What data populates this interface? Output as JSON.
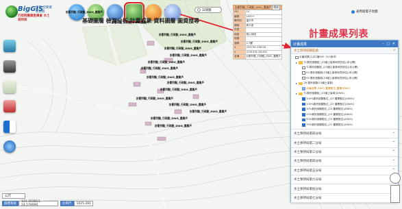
{
  "app": {
    "brand": "BigGIS",
    "brand_sub": "巨量 空間資訊系統",
    "unit": "行政院農業委員會 水土保持局"
  },
  "toolbar": {
    "caption": "基礎圖層 檢測分析 計畫成果 資料圖層 圖資搜尋"
  },
  "map_toggle": {
    "label": "日間圖"
  },
  "coord_select": {
    "label": "通用版電子地圖"
  },
  "callout": {
    "title": "計畫成果列表"
  },
  "attr_table": {
    "title": "計劃列點_行政點_DWG_農業戶",
    "close": "關閉",
    "rows": [
      {
        "k": "FID",
        "v": "10"
      },
      {
        "k": "編號",
        "v": "1000+"
      },
      {
        "k": "縣市別",
        "v": "臺中市"
      },
      {
        "k": "鄉鎮",
        "v": "和平區"
      },
      {
        "k": "村里",
        "v": ""
      },
      {
        "k": "地段",
        "v": "梨山地段"
      },
      {
        "k": "地號",
        "v": ""
      },
      {
        "k": "面積",
        "v": "2.7鍵"
      },
      {
        "k": "X",
        "v": "253790.376026"
      },
      {
        "k": "Y",
        "v": "2734378.330591"
      },
      {
        "k": "名稱",
        "v": "計劃列點_行政點_DWG_農業戶"
      }
    ]
  },
  "parcel_labels": [
    "計劃列點_行政點_DWG_農業戶",
    "計劃列點_行政點_DWG_農業戶",
    "計劃列點_行政點_DWG_農業戶",
    "計劃列點_行政點_DWG_農業戶",
    "計劃列點_行政點_DWG_農業戶",
    "計劃列點_行政點_DWG_農業戶",
    "計劃列點_行政點_DWG_農業戶",
    "計劃列點_行政點_DWG_農業戶",
    "計劃列點_行政點_DWG_農業戶",
    "計劃列點_行政點_DWG_農業戶",
    "計劃列點_行政點_DWG_農業戶",
    "計劃列點_行政點_DWG_農業戶",
    "計劃列點_行政點_DWG_農業戶",
    "計劃列點_行政點_DWG_農業戶",
    "計劃列點_行政點_DWG_農業戶",
    "計劃列點_行政點_DWG_農業戶"
  ],
  "panel": {
    "title": "計畫成果",
    "controls": "– □ ✕",
    "active_section": "水土保持局轄區處",
    "tree": [
      {
        "ind": 0,
        "type": "cb",
        "on": false,
        "text": "計畫成果(1)共2筆GIS（9/1版本）"
      },
      {
        "ind": 1,
        "type": "folder",
        "text": "TC委託檢驗航_(23國土保育地質評估)(未公開)"
      },
      {
        "ind": 2,
        "type": "cb",
        "on": false,
        "text": "TC委託檢驗航_(23國土保育地質評估)(未公開)"
      },
      {
        "ind": 2,
        "type": "cb",
        "on": false,
        "text": "03 委託檢驗航(23國土保育地質評估)(未公開)"
      },
      {
        "ind": 2,
        "type": "cb",
        "on": false,
        "text": "05 委託檢驗航(23國土保育地質評估)(未公開)"
      },
      {
        "ind": 1,
        "type": "folder",
        "text": "28 委託檢驗(23國土保育)"
      },
      {
        "ind": 2,
        "type": "layer",
        "hl": true,
        "text": "計畫成果_DWG_農業點位_農業(DWG)"
      },
      {
        "ind": 1,
        "type": "folder",
        "text": "TC委託檢驗航_(23國土保育)(DWG)"
      },
      {
        "ind": 2,
        "type": "cb",
        "on": true,
        "text": "100%委託檢驗點位_(23 農業點位)(DWG)"
      },
      {
        "ind": 2,
        "type": "cb",
        "on": true,
        "text": "100%委託檢驗點位_(23 農業點位)(DWG)"
      },
      {
        "ind": 2,
        "type": "cb",
        "on": true,
        "text": "10%委託檢驗點位_(23 農業點位)(DWG)"
      },
      {
        "ind": 2,
        "type": "cb",
        "on": true,
        "text": "25%委託檢驗點位_(23 農業點位)(DWG)"
      },
      {
        "ind": 2,
        "type": "cb",
        "on": true,
        "text": "50%委託檢驗點位_(23 農業點位)(DWG)"
      },
      {
        "ind": 2,
        "type": "cb",
        "on": true,
        "text": "75%委託檢驗點位_(23 農業點位)(DWG)"
      },
      {
        "ind": 2,
        "type": "cb",
        "on": true,
        "text": "75%委託檢驗點位_(23 農業點位)(DWG)"
      },
      {
        "ind": 2,
        "type": "cb",
        "on": true,
        "text": "75%委託檢驗點位_(23 農業點位)(DWG)"
      },
      {
        "ind": 1,
        "type": "cb",
        "on": true,
        "text": "TC 委託檢驗航_(23國土保育)(DWG)"
      },
      {
        "ind": 1,
        "type": "cb",
        "on": true,
        "text": "TC 委託檢驗航_(23國土保育)(DWG)"
      }
    ],
    "lower_sections": [
      "水土保持局第四分局",
      "水土保持局第二分局",
      "水土保持局第三分局",
      "水土保持局第四分局",
      "水土保持局第五分局",
      "水土保持局第六分局",
      "水土保持局南投分局",
      "水土保持局第七分局"
    ],
    "expand_icon": "^",
    "collapse_icon": "v"
  },
  "status": {
    "unit_label": "公尺",
    "coord_label": "座標系統",
    "coord_value": "121.303813, 24.578990",
    "scale_label": "比例尺",
    "scale_value": "1625.281"
  },
  "colors": {
    "accent": "#3d79c4",
    "callout": "#e0334a",
    "attr_key": "#f7c9a4"
  }
}
